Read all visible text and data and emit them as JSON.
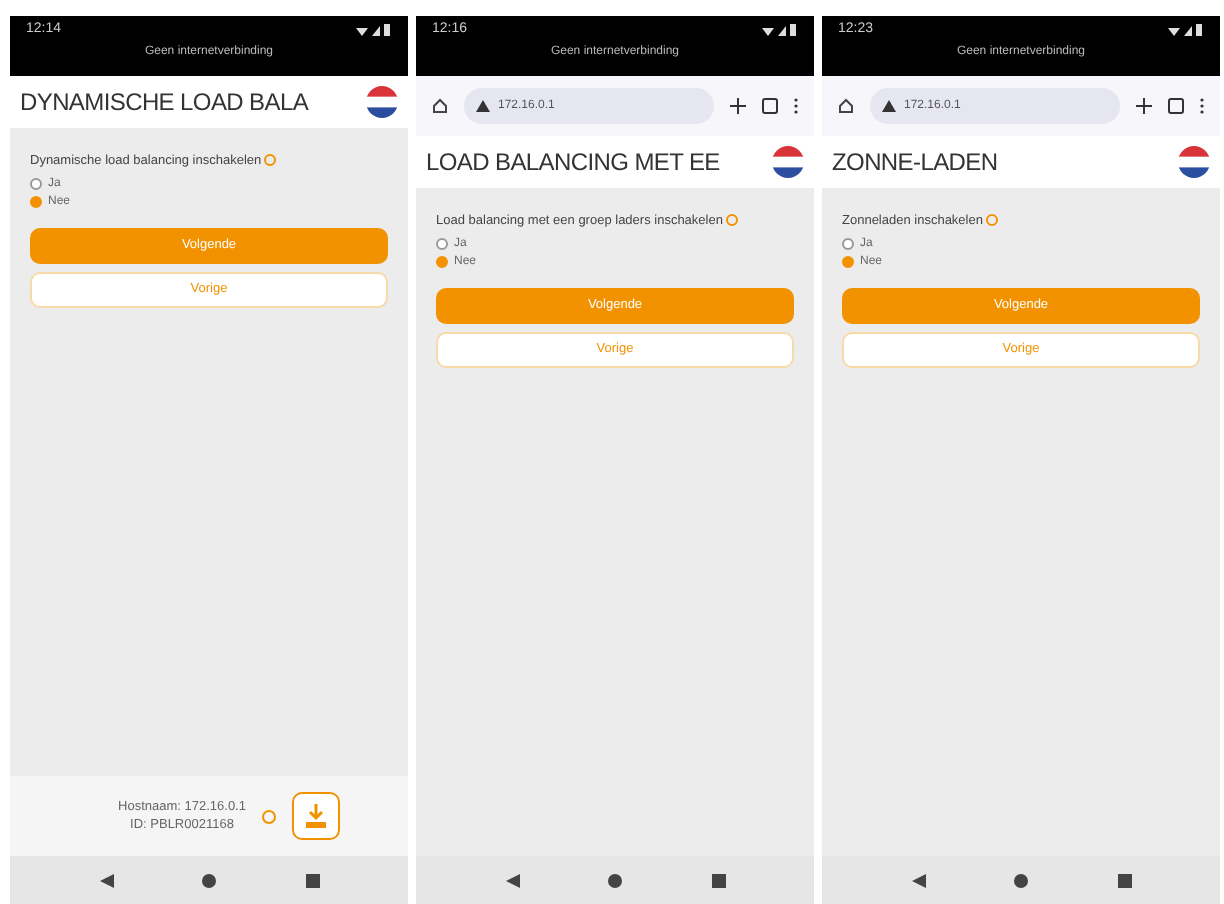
{
  "screens": [
    {
      "status_bar": {
        "time": "12:14"
      },
      "notice": "Geen internetverbinding",
      "header": {
        "title": "DYNAMISCHE LOAD BALA"
      },
      "question": "Dynamische load balancing inschakelen",
      "options": [
        {
          "label": "Ja",
          "selected": false
        },
        {
          "label": "Nee",
          "selected": true
        }
      ],
      "buttons": [
        {
          "kind": "primary",
          "label": "Volgende"
        },
        {
          "kind": "secondary",
          "label": "Vorige"
        }
      ],
      "footer": {
        "lines": [
          "Hostnaam: 172.16.0.1",
          "ID: PBLR0021168"
        ]
      }
    },
    {
      "status_bar": {
        "time": "12:16"
      },
      "notice": "Geen internetverbinding",
      "browser": {
        "url": "172.16.0.1"
      },
      "header": {
        "title": "LOAD BALANCING MET EE"
      },
      "question": "Load balancing met een groep laders inschakelen",
      "options": [
        {
          "label": "Ja",
          "selected": false
        },
        {
          "label": "Nee",
          "selected": true
        }
      ],
      "buttons": [
        {
          "kind": "primary",
          "label": "Volgende"
        },
        {
          "kind": "secondary",
          "label": "Vorige"
        }
      ]
    },
    {
      "status_bar": {
        "time": "12:23"
      },
      "notice": "Geen internetverbinding",
      "browser": {
        "url": "172.16.0.1"
      },
      "header": {
        "title": "ZONNE-LADEN"
      },
      "question": "Zonneladen inschakelen",
      "options": [
        {
          "label": "Ja",
          "selected": false
        },
        {
          "label": "Nee",
          "selected": true
        }
      ],
      "buttons": [
        {
          "kind": "primary",
          "label": "Volgende"
        },
        {
          "kind": "secondary",
          "label": "Vorige"
        }
      ]
    }
  ]
}
